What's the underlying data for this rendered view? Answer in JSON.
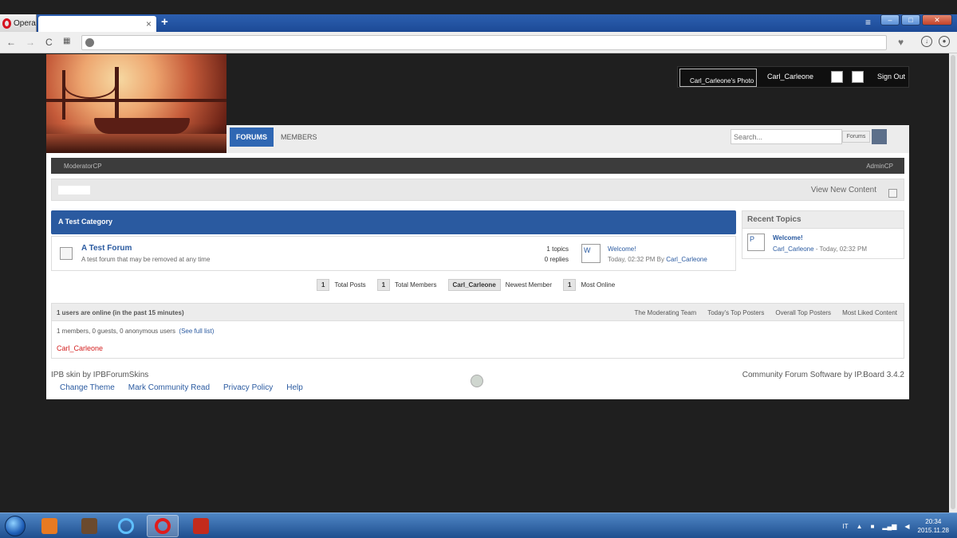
{
  "browser": {
    "menu_label": "Opera",
    "tab_close": "×",
    "new_tab": "+"
  },
  "header": {
    "user_photo_alt": "Carl_Carleone's Photo",
    "username": "Carl_Carleone",
    "sign_out": "Sign Out"
  },
  "nav": {
    "forums": "FORUMS",
    "members": "MEMBERS",
    "search_placeholder": "Search...",
    "search_scope": "Forums"
  },
  "admin_bar": {
    "left": "ModeratorCP",
    "right": "AdminCP"
  },
  "breadcrumb": {
    "view_new": "View New Content"
  },
  "category": {
    "title": "A Test Category"
  },
  "forum": {
    "title": "A Test Forum",
    "description": "A test forum that may be removed at any time",
    "topics": "1 topics",
    "replies": "0 replies",
    "last_post_avatar_alt": "W",
    "last_post_title": "Welcome!",
    "last_post_meta": "Today, 02:32 PM By ",
    "last_post_user": "Carl_Carleone"
  },
  "recent_topics": {
    "title": "Recent Topics",
    "avatar_alt": "P",
    "topic_title": "Welcome!",
    "topic_user": "Carl_Carleone",
    "topic_meta": " - Today, 02:32 PM"
  },
  "stats": [
    {
      "value": "1",
      "label": "Total Posts"
    },
    {
      "value": "1",
      "label": "Total Members"
    },
    {
      "value": "Carl_Carleone",
      "label": "Newest Member"
    },
    {
      "value": "1",
      "label": "Most Online"
    }
  ],
  "online": {
    "title": "1 users are online (in the past 15 minutes)",
    "links": [
      "The Moderating Team",
      "Today's Top Posters",
      "Overall Top Posters",
      "Most Liked Content"
    ],
    "summary": "1 members, 0 guests, 0 anonymous users",
    "see_full": "(See full list)",
    "user": "Carl_Carleone"
  },
  "footer": {
    "skin_credit": "IPB skin by IPBForumSkins",
    "links": [
      "Change Theme",
      "Mark Community Read",
      "Privacy Policy",
      "Help"
    ],
    "software": "Community Forum Software by IP.Board 3.4.2"
  },
  "taskbar": {
    "language": "IT",
    "time": "20:34",
    "date": "2015.11.28"
  }
}
